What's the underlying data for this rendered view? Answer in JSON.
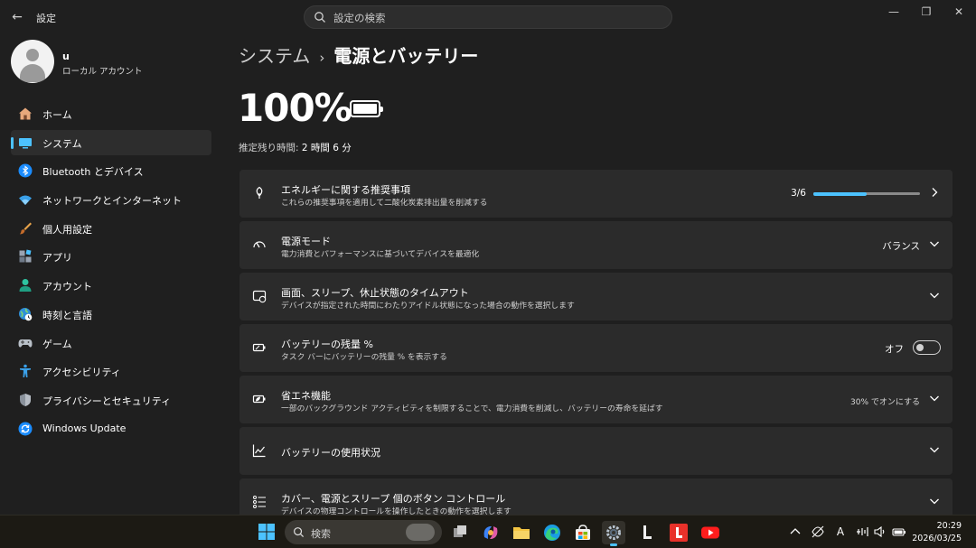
{
  "window": {
    "title": "設定",
    "search_placeholder": "設定の検索",
    "controls": {
      "minimize": "—",
      "maximize": "❐",
      "close": "✕"
    }
  },
  "profile": {
    "name": "u",
    "account_type": "ローカル アカウント"
  },
  "sidebar": {
    "items": [
      {
        "label": "ホーム",
        "icon": "home-icon"
      },
      {
        "label": "システム",
        "icon": "system-icon",
        "active": true
      },
      {
        "label": "Bluetooth とデバイス",
        "icon": "bluetooth-icon"
      },
      {
        "label": "ネットワークとインターネット",
        "icon": "wifi-icon"
      },
      {
        "label": "個人用設定",
        "icon": "brush-icon"
      },
      {
        "label": "アプリ",
        "icon": "apps-icon"
      },
      {
        "label": "アカウント",
        "icon": "account-icon"
      },
      {
        "label": "時刻と言語",
        "icon": "globe-clock-icon"
      },
      {
        "label": "ゲーム",
        "icon": "gamepad-icon"
      },
      {
        "label": "アクセシビリティ",
        "icon": "accessibility-icon"
      },
      {
        "label": "プライバシーとセキュリティ",
        "icon": "shield-icon"
      },
      {
        "label": "Windows Update",
        "icon": "update-icon"
      }
    ]
  },
  "breadcrumb": {
    "parent": "システム",
    "separator": "›",
    "current": "電源とバッテリー"
  },
  "battery": {
    "percent_text": "100%",
    "level": 1.0,
    "remaining_label": "推定残り時間:",
    "remaining_value": "2 時間 6 分"
  },
  "cards": {
    "energy": {
      "title": "エネルギーに関する推奨事項",
      "subtitle": "これらの推奨事項を適用して二酸化炭素排出量を削減する",
      "progress_text": "3/6",
      "progress": 0.5
    },
    "power_mode": {
      "title": "電源モード",
      "subtitle": "電力消費とパフォーマンスに基づいてデバイスを最適化",
      "value": "バランス"
    },
    "screen_sleep": {
      "title": "画面、スリープ、休止状態のタイムアウト",
      "subtitle": "デバイスが指定された時間にわたりアイドル状態になった場合の動作を選択します"
    },
    "battery_pct": {
      "title": "バッテリーの残量 %",
      "subtitle": "タスク バーにバッテリーの残量 % を表示する",
      "toggle_label": "オフ",
      "toggle_on": false
    },
    "energy_saver": {
      "title": "省エネ機能",
      "subtitle": "一部のバックグラウンド アクティビティを制限することで、電力消費を削減し、バッテリーの寿命を延ばす",
      "value": "30% でオンにする"
    },
    "battery_usage": {
      "title": "バッテリーの使用状況"
    },
    "lid_buttons": {
      "title": "カバー、電源とスリープ 個のボタン コントロール",
      "subtitle": "デバイスの物理コントロールを操作したときの動作を選択します"
    }
  },
  "taskbar": {
    "search_placeholder": "検索",
    "apps": [
      "task-view-icon",
      "copilot-icon",
      "file-explorer-icon",
      "edge-icon",
      "store-icon",
      "settings-icon",
      "l-app-icon",
      "l-red-app-icon",
      "youtube-icon"
    ],
    "clock_time": "20:29",
    "clock_date": "2026/03/25",
    "tray_ime": "A"
  },
  "colors": {
    "accent": "#4cc2ff",
    "background": "#1f1f1f",
    "card": "#2b2b2b",
    "taskbar": "#1c1a14"
  }
}
